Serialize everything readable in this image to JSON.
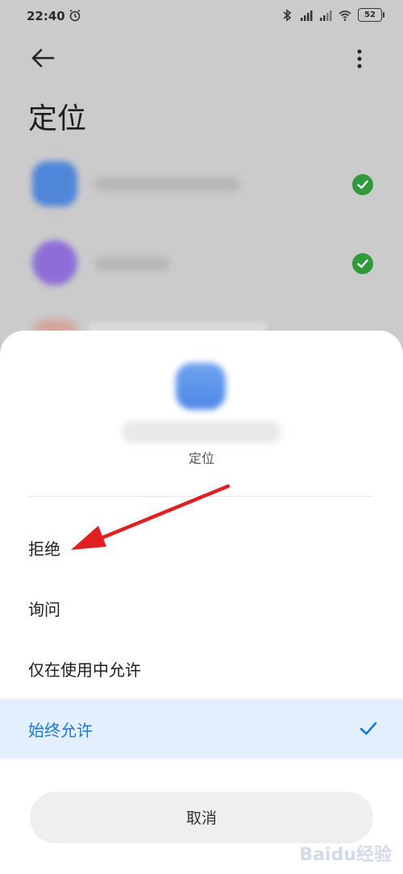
{
  "status_bar": {
    "time": "22:40",
    "battery": "52"
  },
  "header": {
    "title": "定位"
  },
  "sheet": {
    "subtitle": "定位",
    "options": [
      {
        "label": "拒绝"
      },
      {
        "label": "询问"
      },
      {
        "label": "仅在使用中允许"
      },
      {
        "label": "始终允许",
        "selected": true
      }
    ],
    "cancel_label": "取消"
  },
  "colors": {
    "accent": "#1a78db",
    "granted_green": "#2f9a3a",
    "annotation_arrow": "#e02020"
  },
  "watermark": {
    "text": "Baidu经验"
  }
}
